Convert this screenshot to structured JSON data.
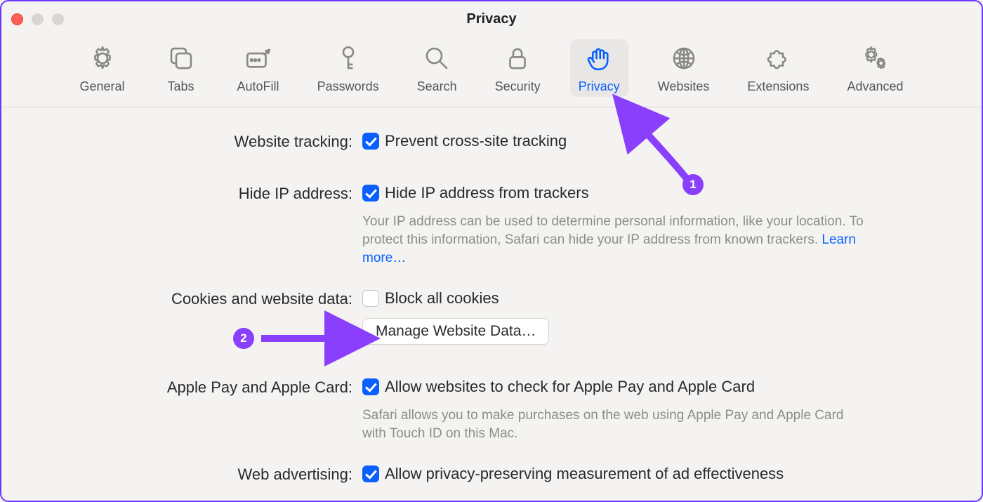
{
  "window": {
    "title": "Privacy"
  },
  "toolbar": {
    "tabs": [
      {
        "id": "general",
        "label": "General"
      },
      {
        "id": "tabs",
        "label": "Tabs"
      },
      {
        "id": "autofill",
        "label": "AutoFill"
      },
      {
        "id": "passwords",
        "label": "Passwords"
      },
      {
        "id": "search",
        "label": "Search"
      },
      {
        "id": "security",
        "label": "Security"
      },
      {
        "id": "privacy",
        "label": "Privacy"
      },
      {
        "id": "websites",
        "label": "Websites"
      },
      {
        "id": "extensions",
        "label": "Extensions"
      },
      {
        "id": "advanced",
        "label": "Advanced"
      }
    ],
    "activeIndex": 6
  },
  "sections": {
    "websiteTracking": {
      "label": "Website tracking:",
      "checkbox": {
        "checked": true,
        "text": "Prevent cross-site tracking"
      }
    },
    "hideIP": {
      "label": "Hide IP address:",
      "checkbox": {
        "checked": true,
        "text": "Hide IP address from trackers"
      },
      "description": "Your IP address can be used to determine personal information, like your location. To protect this information, Safari can hide your IP address from known trackers. ",
      "learnMore": "Learn more…"
    },
    "cookies": {
      "label": "Cookies and website data:",
      "checkbox": {
        "checked": false,
        "text": "Block all cookies"
      },
      "button": "Manage Website Data…"
    },
    "applePay": {
      "label": "Apple Pay and Apple Card:",
      "checkbox": {
        "checked": true,
        "text": "Allow websites to check for Apple Pay and Apple Card"
      },
      "description": "Safari allows you to make purchases on the web using Apple Pay and Apple Card with Touch ID on this Mac."
    },
    "webAdvertising": {
      "label": "Web advertising:",
      "checkbox": {
        "checked": true,
        "text": "Allow privacy-preserving measurement of ad effectiveness"
      }
    }
  },
  "annotations": {
    "badge1": "1",
    "badge2": "2"
  }
}
